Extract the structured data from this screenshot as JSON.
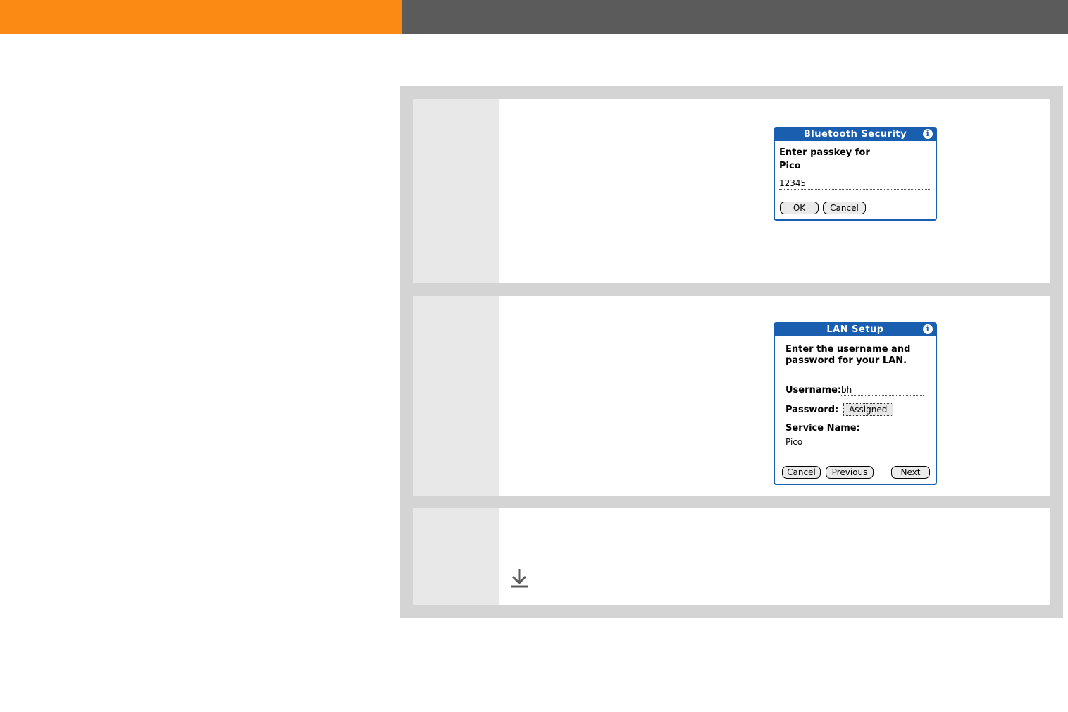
{
  "bluetooth_dialog": {
    "title": "Bluetooth Security",
    "prompt_line1": "Enter passkey for",
    "prompt_line2": "Pico",
    "passkey_value": "12345",
    "ok_label": "OK",
    "cancel_label": "Cancel"
  },
  "lan_dialog": {
    "title": "LAN Setup",
    "prompt_line1": "Enter the username and",
    "prompt_line2": "password for your LAN.",
    "username_label": "Username:",
    "username_value": "bh",
    "password_label": "Password:",
    "password_value": "-Assigned-",
    "service_label": "Service Name:",
    "service_value": "Pico",
    "cancel_label": "Cancel",
    "previous_label": "Previous",
    "next_label": "Next"
  },
  "colors": {
    "header_orange": "#fb8a15",
    "header_gray": "#5b5b5b",
    "dialog_blue": "#1a5eb0"
  },
  "icons": {
    "info": "info-icon",
    "down_arrow": "down-arrow-icon"
  }
}
